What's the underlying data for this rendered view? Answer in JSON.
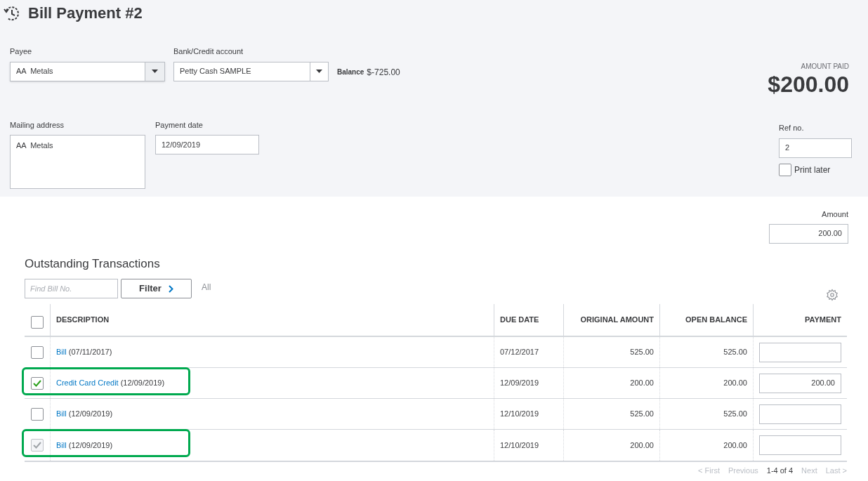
{
  "title": "Bill Payment #2",
  "payee": {
    "label": "Payee",
    "value": "AA  Metals"
  },
  "account": {
    "label": "Bank/Credit account",
    "value": "Petty Cash SAMPLE",
    "balance_label": "Balance",
    "balance": "$-725.00"
  },
  "amount_paid": {
    "label": "AMOUNT PAID",
    "value": "$200.00"
  },
  "mailing_address": {
    "label": "Mailing address",
    "value": "AA  Metals"
  },
  "payment_date": {
    "label": "Payment date",
    "value": "12/09/2019"
  },
  "ref_no": {
    "label": "Ref no.",
    "value": "2"
  },
  "print_later": {
    "label": "Print later",
    "checked": false
  },
  "amount": {
    "label": "Amount",
    "value": "200.00"
  },
  "outstanding": {
    "heading": "Outstanding Transactions",
    "search_placeholder": "Find Bill No.",
    "filter_button": "Filter",
    "filter_value": "All",
    "select_all_checked": false,
    "columns": [
      "DESCRIPTION",
      "DUE DATE",
      "ORIGINAL AMOUNT",
      "OPEN BALANCE",
      "PAYMENT"
    ],
    "rows": [
      {
        "link": "Bill",
        "detail": "(07/11/2017)",
        "due_date": "07/12/2017",
        "original_amount": "525.00",
        "open_balance": "525.00",
        "payment": "",
        "checked": false,
        "disabled": false,
        "highlighted": false
      },
      {
        "link": "Credit Card Credit",
        "detail": "(12/09/2019)",
        "due_date": "12/09/2019",
        "original_amount": "200.00",
        "open_balance": "200.00",
        "payment": "200.00",
        "checked": true,
        "disabled": false,
        "highlighted": true
      },
      {
        "link": "Bill",
        "detail": "(12/09/2019)",
        "due_date": "12/10/2019",
        "original_amount": "525.00",
        "open_balance": "525.00",
        "payment": "",
        "checked": false,
        "disabled": false,
        "highlighted": false
      },
      {
        "link": "Bill",
        "detail": "(12/09/2019)",
        "due_date": "12/10/2019",
        "original_amount": "200.00",
        "open_balance": "200.00",
        "payment": "",
        "checked": true,
        "disabled": true,
        "highlighted": true
      }
    ],
    "pagination": {
      "first": "< First",
      "previous": "Previous",
      "range": "1-4 of 4",
      "next": "Next",
      "last": "Last >"
    }
  }
}
